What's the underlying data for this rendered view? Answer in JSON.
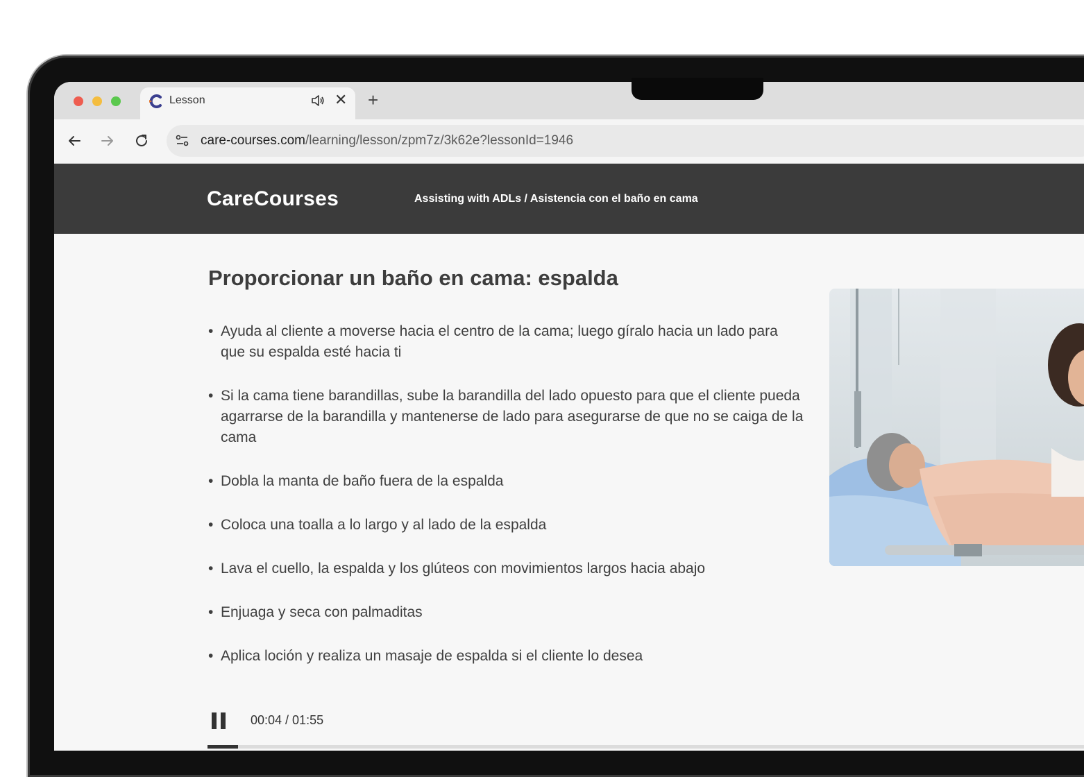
{
  "browser": {
    "tab_title": "Lesson",
    "url_host": "care-courses.com",
    "url_path": "/learning/lesson/zpm7z/3k62e?lessonId=1946",
    "new_tab_label": "+",
    "close_tab_label": "✕"
  },
  "site": {
    "logo": "CareCourses",
    "breadcrumb": "Assisting with ADLs / Asistencia con el baño en cama"
  },
  "lesson": {
    "title": "Proporcionar un baño en cama: espalda",
    "bullets": [
      "Ayuda al cliente a moverse hacia el centro de la cama; luego gíralo hacia un lado para que su espalda esté hacia ti",
      "Si la cama tiene barandillas, sube la barandilla del lado opuesto para que el cliente pueda agarrarse de la barandilla y mantenerse de lado para asegurarse de que no se caiga de la cama",
      "Dobla la manta de baño fuera de la espalda",
      "Coloca una toalla a lo largo y al lado de la espalda",
      "Lava el cuello, la espalda y los glúteos con movimientos largos hacia abajo",
      "Enjuaga y seca con palmaditas",
      "Aplica loción y realiza un masaje de espalda si el cliente lo desea"
    ]
  },
  "player": {
    "time": "00:04 / 01:55",
    "progress_fraction": 0.035
  },
  "colors": {
    "header_bg": "#3b3b3b",
    "page_bg": "#f7f7f7",
    "text": "#3f3f3f"
  }
}
